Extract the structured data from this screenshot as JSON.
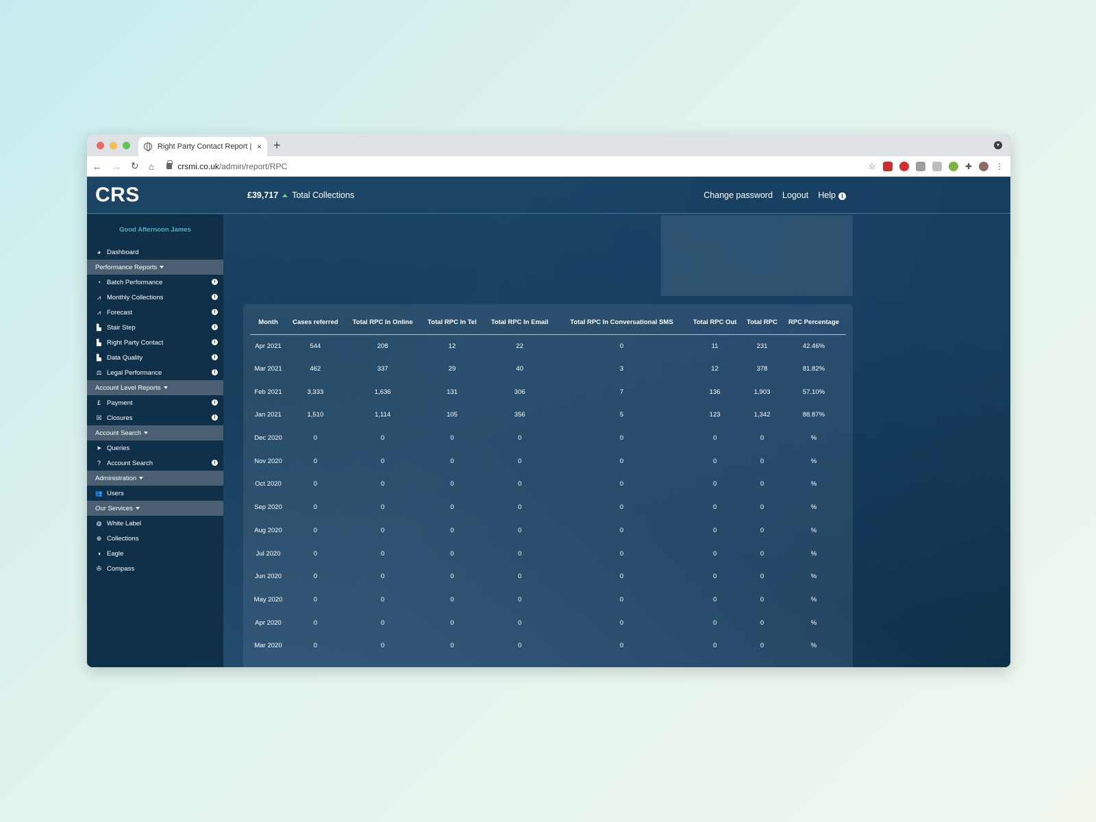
{
  "browser": {
    "tab_title": "Right Party Contact Report | Cr",
    "tab_close": "×",
    "new_tab": "+",
    "url_domain": "crsmi.co.uk",
    "url_path": "/admin/report/RPC"
  },
  "header": {
    "logo": "CRS",
    "total_amount": "£39,717",
    "total_label": "Total Collections",
    "links": [
      "Change password",
      "Logout",
      "Help"
    ]
  },
  "sidebar": {
    "greeting": "Good Afternoon James",
    "dashboard": "Dashboard",
    "sections": [
      {
        "title": "Performance Reports",
        "items": [
          "Batch Performance",
          "Monthly Collections",
          "Forecast",
          "Stair Step",
          "Right Party Contact",
          "Data Quality",
          "Legal Performance"
        ]
      },
      {
        "title": "Account Level Reports",
        "items": [
          "Payment",
          "Closures"
        ]
      },
      {
        "title": "Account Search",
        "items": [
          "Queries",
          "Account Search"
        ]
      },
      {
        "title": "Administration",
        "items": [
          "Users"
        ]
      },
      {
        "title": "Our Services",
        "items": [
          "White Label",
          "Collections",
          "Eagle",
          "Compass"
        ]
      }
    ]
  },
  "table": {
    "columns": [
      "Month",
      "Cases referred",
      "Total RPC In Online",
      "Total RPC In Tel",
      "Total RPC In Email",
      "Total RPC In Conversational SMS",
      "Total RPC Out",
      "Total RPC",
      "RPC Percentage"
    ],
    "rows": [
      [
        "Apr 2021",
        "544",
        "208",
        "12",
        "22",
        "0",
        "11",
        "231",
        "42.46%"
      ],
      [
        "Mar 2021",
        "462",
        "337",
        "29",
        "40",
        "3",
        "12",
        "378",
        "81.82%"
      ],
      [
        "Feb 2021",
        "3,333",
        "1,636",
        "131",
        "306",
        "7",
        "136",
        "1,903",
        "57.10%"
      ],
      [
        "Jan 2021",
        "1,510",
        "1,114",
        "105",
        "356",
        "5",
        "123",
        "1,342",
        "88.87%"
      ],
      [
        "Dec 2020",
        "0",
        "0",
        "0",
        "0",
        "0",
        "0",
        "0",
        "%"
      ],
      [
        "Nov 2020",
        "0",
        "0",
        "0",
        "0",
        "0",
        "0",
        "0",
        "%"
      ],
      [
        "Oct 2020",
        "0",
        "0",
        "0",
        "0",
        "0",
        "0",
        "0",
        "%"
      ],
      [
        "Sep 2020",
        "0",
        "0",
        "0",
        "0",
        "0",
        "0",
        "0",
        "%"
      ],
      [
        "Aug 2020",
        "0",
        "0",
        "0",
        "0",
        "0",
        "0",
        "0",
        "%"
      ],
      [
        "Jul 2020",
        "0",
        "0",
        "0",
        "0",
        "0",
        "0",
        "0",
        "%"
      ],
      [
        "Jun 2020",
        "0",
        "0",
        "0",
        "0",
        "0",
        "0",
        "0",
        "%"
      ],
      [
        "May 2020",
        "0",
        "0",
        "0",
        "0",
        "0",
        "0",
        "0",
        "%"
      ],
      [
        "Apr 2020",
        "0",
        "0",
        "0",
        "0",
        "0",
        "0",
        "0",
        "%"
      ],
      [
        "Mar 2020",
        "0",
        "0",
        "0",
        "0",
        "0",
        "0",
        "0",
        "%"
      ]
    ]
  }
}
